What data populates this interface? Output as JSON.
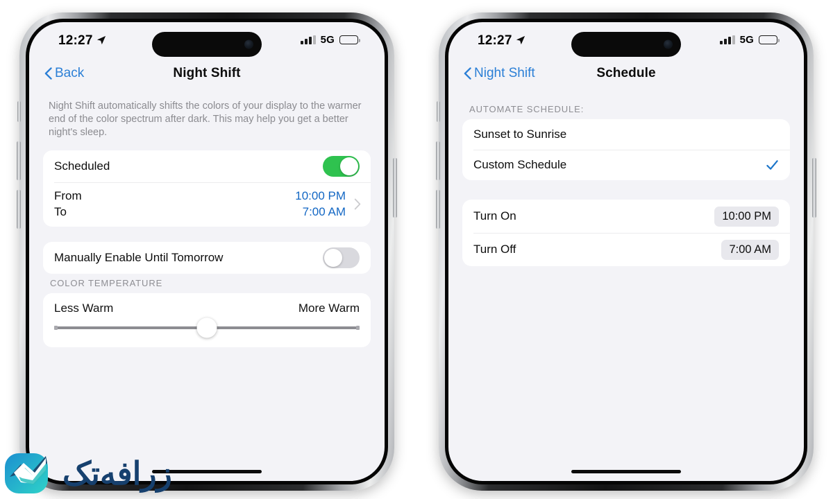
{
  "status_bar": {
    "time": "12:27",
    "location_icon": "location-arrow-icon",
    "signal_icon": "cellular-bars-icon",
    "network": "5G",
    "battery_icon": "battery-icon"
  },
  "colors": {
    "accent_blue": "#2b7fd6",
    "value_blue": "#1367c4",
    "toggle_on_green": "#2fc24f",
    "toggle_off_gray": "#d9d9de",
    "page_background": "#f3f3f7",
    "card_background": "#ffffff",
    "secondary_text": "#8e8e93",
    "pill_background": "#e8e8ed"
  },
  "phone_left": {
    "nav": {
      "back_label": "Back",
      "back_icon": "chevron-left-icon",
      "title": "Night Shift"
    },
    "blurb": "Night Shift automatically shifts the colors of your display to the warmer end of the color spectrum after dark. This may help you get a better night's sleep.",
    "scheduled": {
      "label": "Scheduled",
      "toggle_state": "on"
    },
    "from_to": {
      "from_label": "From",
      "to_label": "To",
      "from_value": "10:00 PM",
      "to_value": "7:00 AM",
      "disclosure_icon": "chevron-right-icon"
    },
    "manual": {
      "label": "Manually Enable Until Tomorrow",
      "toggle_state": "off"
    },
    "color_temperature": {
      "header": "COLOR TEMPERATURE",
      "min_label": "Less Warm",
      "max_label": "More Warm",
      "value_percent": 50
    }
  },
  "phone_right": {
    "nav": {
      "back_label": "Night Shift",
      "back_icon": "chevron-left-icon",
      "title": "Schedule"
    },
    "automate": {
      "header": "AUTOMATE SCHEDULE:",
      "options": [
        {
          "label": "Sunset to Sunrise",
          "selected": false
        },
        {
          "label": "Custom Schedule",
          "selected": true
        }
      ],
      "check_icon": "checkmark-icon"
    },
    "times": [
      {
        "label": "Turn On",
        "value": "10:00 PM"
      },
      {
        "label": "Turn Off",
        "value": "7:00 AM"
      }
    ]
  },
  "watermark": {
    "logo_icon": "check-badge-logo-icon",
    "text": "زرافه‌تک"
  }
}
